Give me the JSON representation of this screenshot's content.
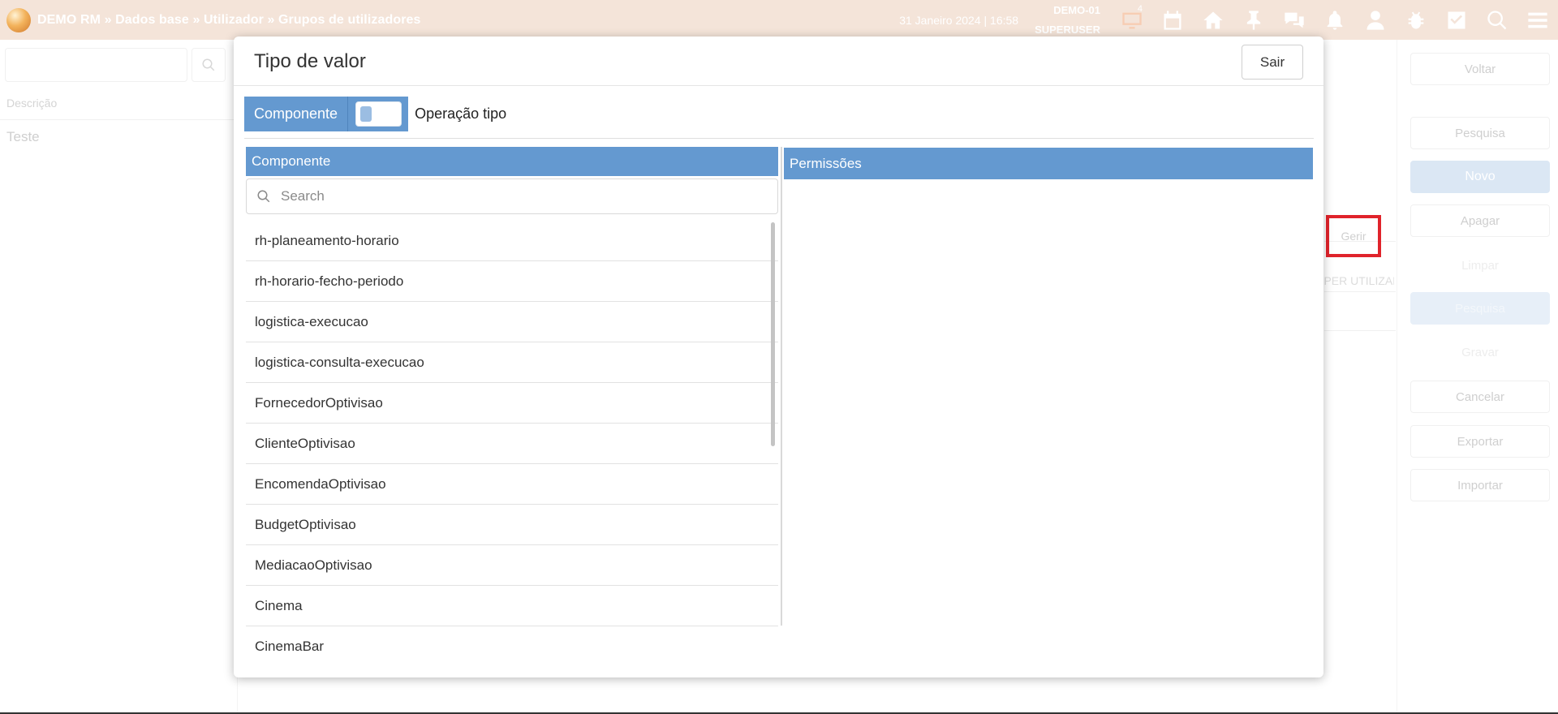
{
  "topbar": {
    "breadcrumb": "DEMO RM » Dados base » Utilizador » Grupos de utilizadores",
    "datetime": "31 Janeiro 2024 | 16:58",
    "user_line1": "DEMO-01",
    "user_line2": "SUPERUSER",
    "monitor_badge": "4",
    "icons": [
      "monitor-icon",
      "calendar-icon",
      "home-icon",
      "pin-icon",
      "chat-icon",
      "bell-icon",
      "user-icon",
      "bug-icon",
      "checkbox-icon",
      "search-icon",
      "menu-icon"
    ]
  },
  "background": {
    "column_header": "Descrição",
    "row_value": "Teste",
    "gerir_label": "Gerir",
    "ghost_text": "SUPER UTILIZADOR",
    "side_buttons": [
      "Voltar",
      "Pesquisa",
      "Novo",
      "Apagar",
      "Limpar",
      "Pesquisa",
      "Gravar",
      "Cancelar",
      "Exportar",
      "Importar"
    ]
  },
  "modal": {
    "title": "Tipo de valor",
    "close_label": "Sair",
    "toggle_left_label": "Componente",
    "toggle_right_label": "Operação tipo",
    "left_header": "Componente",
    "search_placeholder": "Search",
    "items": [
      "rh-planeamento-horario",
      "rh-horario-fecho-periodo",
      "logistica-execucao",
      "logistica-consulta-execucao",
      "FornecedorOptivisao",
      "ClienteOptivisao",
      "EncomendaOptivisao",
      "BudgetOptivisao",
      "MediacaoOptivisao",
      "Cinema",
      "CinemaBar"
    ],
    "right_header": "Permissões"
  },
  "colors": {
    "topbar": "#f4e4d9",
    "accent_blue": "#6499d0",
    "highlight_red": "#e0232b"
  }
}
